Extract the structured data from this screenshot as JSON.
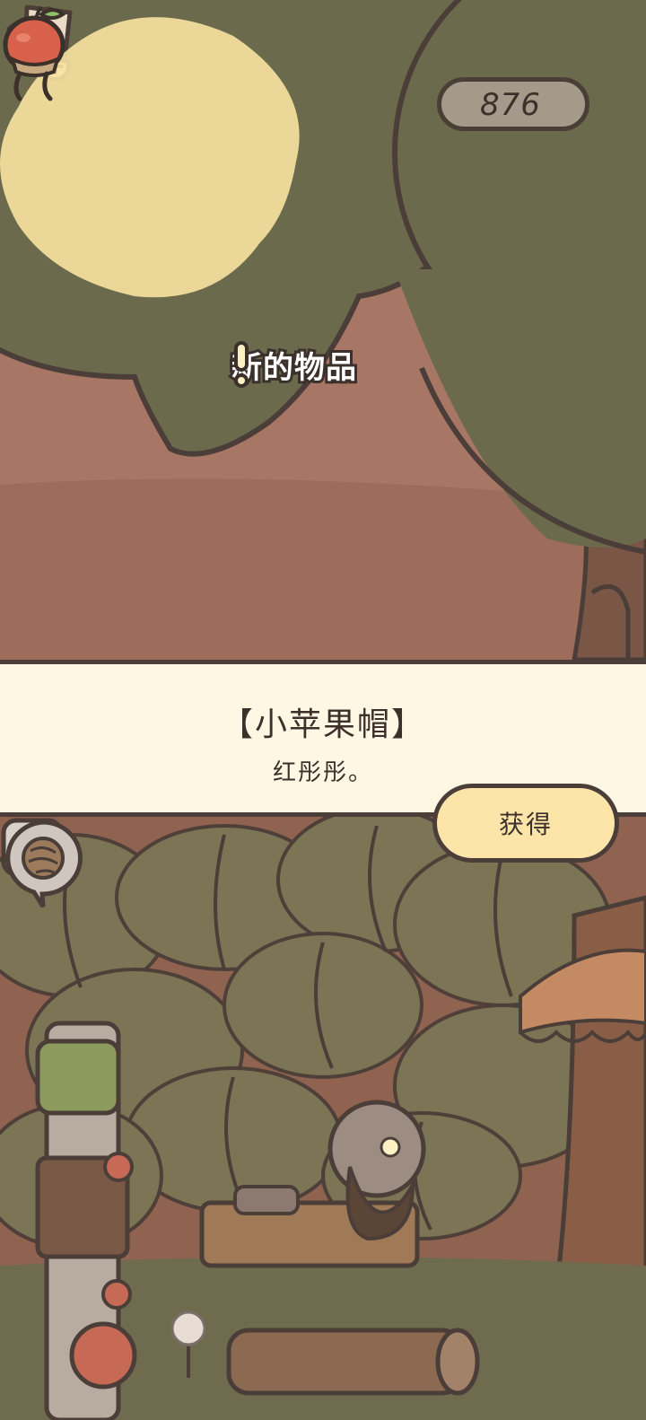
{
  "hud": {
    "currency_value": "876",
    "currency_icon": "acorn-icon",
    "add_icon": "plus-icon",
    "catalog_icon": "catalog-icon"
  },
  "reward": {
    "new_item_label": "新的物品",
    "alert_icon": "exclamation-icon",
    "item_icon": "apple-hat-icon",
    "item_title": "【小苹果帽】",
    "item_description": "红彤彤。",
    "obtain_button_label": "获得"
  },
  "scene": {
    "collapse_icon": "chevron-down-icon",
    "speech_icon": "yarn-ball-icon"
  },
  "colors": {
    "outline": "#4b3e38",
    "banner_bg": "#fdf7e3",
    "button_bg": "#fde4a9",
    "glow": "#fde7a4",
    "canopy": "#6b6a4d"
  }
}
